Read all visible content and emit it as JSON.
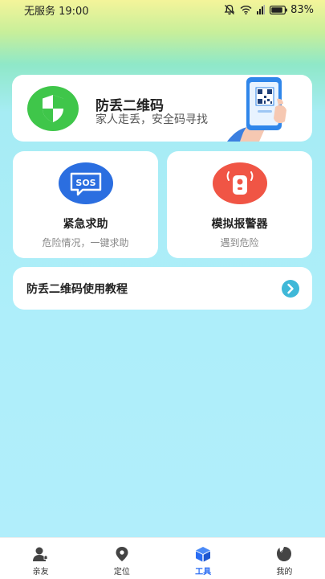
{
  "status": {
    "carrier_time": "无服务 19:00",
    "battery": "83%"
  },
  "banner": {
    "title": "防丢二维码",
    "subtitle": "家人走丢，安全码寻找"
  },
  "tiles": [
    {
      "title": "紧急求助",
      "subtitle": "危险情况，一键求助",
      "icon_text": "SOS"
    },
    {
      "title": "模拟报警器",
      "subtitle": "遇到危险"
    }
  ],
  "tutorial": {
    "label": "防丢二维码使用教程"
  },
  "tabs": [
    {
      "label": "亲友"
    },
    {
      "label": "定位"
    },
    {
      "label": "工具"
    },
    {
      "label": "我的"
    }
  ],
  "colors": {
    "accent": "#2b6df3",
    "shield_green": "#3fc64a",
    "alarm_red": "#f05545"
  }
}
